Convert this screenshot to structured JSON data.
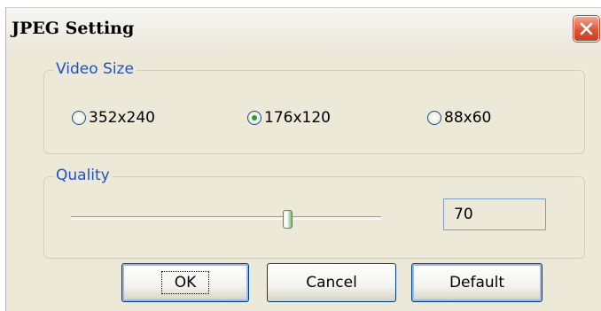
{
  "window": {
    "title": "JPEG Setting"
  },
  "video_size": {
    "legend": "Video Size",
    "options": [
      {
        "label": "352x240",
        "selected": false
      },
      {
        "label": "176x120",
        "selected": true
      },
      {
        "label": "88x60",
        "selected": false
      }
    ]
  },
  "quality": {
    "legend": "Quality",
    "value": "70",
    "slider_fraction": 0.7
  },
  "buttons": {
    "ok": "OK",
    "cancel": "Cancel",
    "default": "Default"
  },
  "icons": {
    "close": "close-icon"
  },
  "colors": {
    "group_label": "#2150c5",
    "close_button": "#d9563a",
    "radio_dot": "#2b9b2b"
  }
}
